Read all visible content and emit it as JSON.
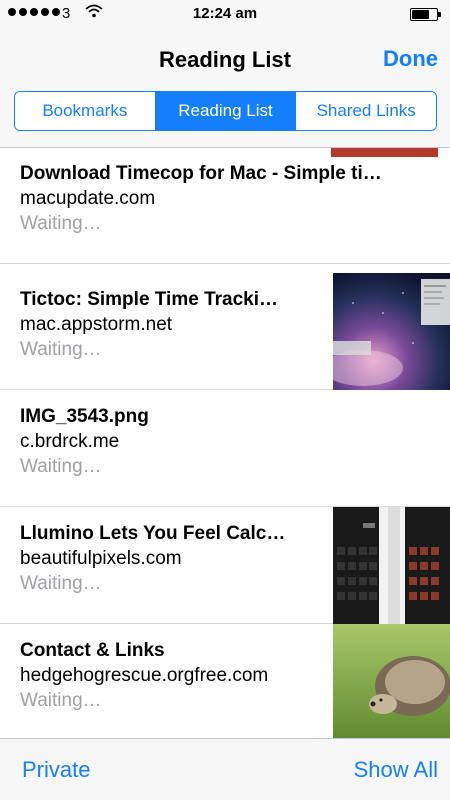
{
  "status_bar": {
    "carrier": "3",
    "time": "12:24 am",
    "signal_bars": 5,
    "signal_filled": 5,
    "battery_level": 0.7
  },
  "nav": {
    "title": "Reading List",
    "done_label": "Done"
  },
  "segments": [
    "Bookmarks",
    "Reading List",
    "Shared Links"
  ],
  "active_segment": "Reading List",
  "items": [
    {
      "title": "Download Timecop for Mac - Simple ti…",
      "host": "macupdate.com",
      "status": "Waiting…",
      "thumbnail": "none"
    },
    {
      "title": "Tictoc: Simple Time Tracki…",
      "host": "mac.appstorm.net",
      "status": "Waiting…",
      "thumbnail": "galaxy-screenshot"
    },
    {
      "title": "IMG_3543.png",
      "host": "c.brdrck.me",
      "status": "Waiting…",
      "thumbnail": "none"
    },
    {
      "title": "Llumino Lets You Feel Calc…",
      "host": "beautifulpixels.com",
      "status": "Waiting…",
      "thumbnail": "calculator-screenshot"
    },
    {
      "title": "Contact & Links",
      "host": "hedgehogrescue.orgfree.com",
      "status": "Waiting…",
      "thumbnail": "hedgehog-photo"
    }
  ],
  "toolbar": {
    "private_label": "Private",
    "show_all_label": "Show All"
  },
  "colors": {
    "accent": "#157efb",
    "secondary_text": "#a0a0a5",
    "bar_background": "#f7f7f7"
  }
}
